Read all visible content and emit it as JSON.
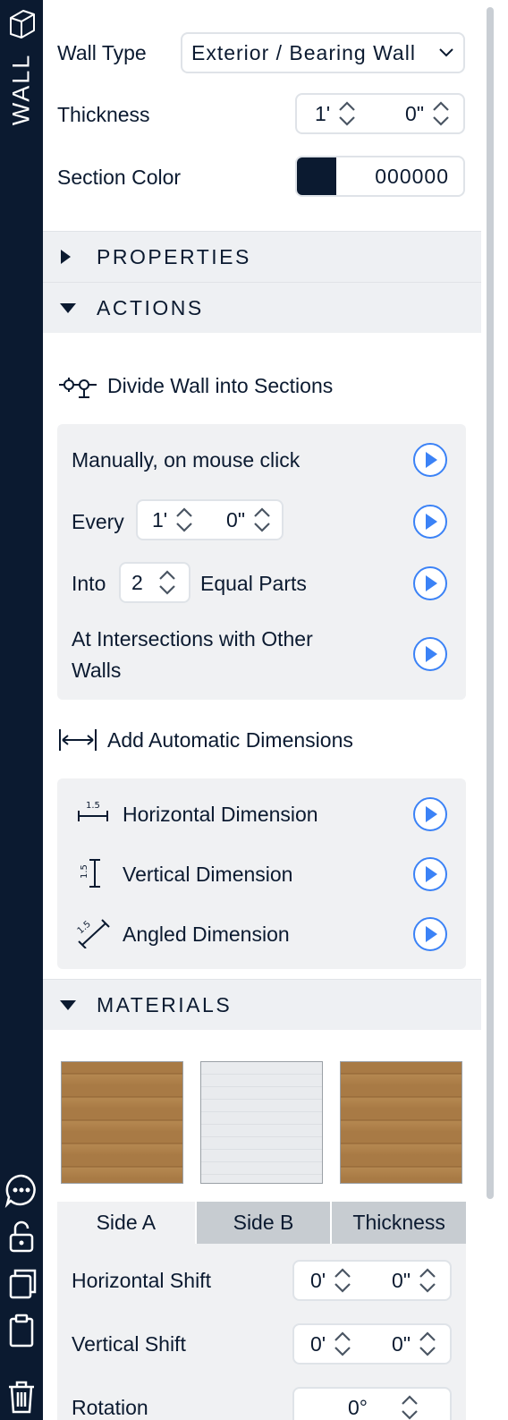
{
  "sidebar": {
    "title": "WALL",
    "icons": [
      "cube-icon",
      "more-icon",
      "lock-icon",
      "copy-icon",
      "clipboard-icon",
      "trash-icon"
    ]
  },
  "wall_type": {
    "label": "Wall Type",
    "value": "Exterior / Bearing Wall"
  },
  "thickness": {
    "label": "Thickness",
    "feet": "1'",
    "inches": "0\""
  },
  "section_color": {
    "label": "Section Color",
    "hex": "000000",
    "swatch": "#0b1a30"
  },
  "sections": {
    "properties": "PROPERTIES",
    "actions": "ACTIONS",
    "materials": "MATERIALS"
  },
  "divide": {
    "title": "Divide Wall into Sections",
    "manual": "Manually, on mouse click",
    "every_label": "Every",
    "every_feet": "1'",
    "every_inches": "0\"",
    "into_label": "Into",
    "into_value": "2",
    "equal_parts": "Equal Parts",
    "intersections_1": "At Intersections with Other",
    "intersections_2": "Walls"
  },
  "auto_dims": {
    "title": "Add Automatic Dimensions",
    "horizontal": "Horizontal Dimension",
    "vertical": "Vertical Dimension",
    "angled": "Angled Dimension",
    "icon_text": "1.5"
  },
  "materials": {
    "tabs": [
      "Side A",
      "Side B",
      "Thickness"
    ],
    "horizontal_shift": {
      "label": "Horizontal Shift",
      "feet": "0'",
      "inches": "0\""
    },
    "vertical_shift": {
      "label": "Vertical Shift",
      "feet": "0'",
      "inches": "0\""
    },
    "rotation": {
      "label": "Rotation",
      "value": "0°"
    }
  },
  "colors": {
    "accent": "#3b82f6",
    "dark": "#0b1a30",
    "section_bg": "#eef0f3"
  }
}
